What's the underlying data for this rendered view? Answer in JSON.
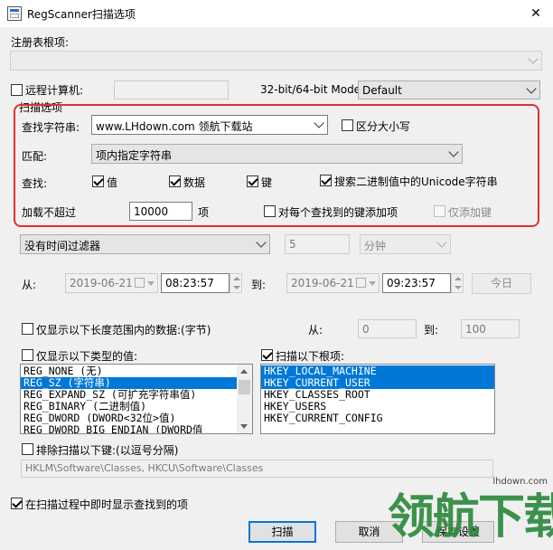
{
  "window": {
    "title": "RegScanner扫描选项",
    "close_glyph": "✕"
  },
  "root_key": {
    "label": "注册表根项:",
    "value": ""
  },
  "remote": {
    "label": "远程计算机:",
    "value": "",
    "checked": false
  },
  "bit_mode": {
    "label": "32-bit/64-bit Mode:",
    "value": "Default"
  },
  "scan_options": {
    "group_label": "扫描选项",
    "find_string_label": "查找字符串:",
    "find_string_value": "www.LHdown.com  领航下载站",
    "case_label": "区分大小写",
    "match_label": "匹配:",
    "match_value": "项内指定字符串",
    "find_label": "查找:",
    "find_value_label": "值",
    "find_data_label": "数据",
    "find_key_label": "键",
    "unicode_label": "搜索二进制值中的Unicode字符串",
    "limit_label": "加载不超过",
    "limit_value": "10000",
    "limit_unit": "项",
    "add_key_label": "对每个查找到的键添加项",
    "only_add_key_label": "仅添加键"
  },
  "time_filter": {
    "value": "没有时间过滤器",
    "amount": "5",
    "unit": "分钟"
  },
  "date_range": {
    "from_label": "从:",
    "from_date": "2019-06-21",
    "from_time": "08:23:57",
    "to_label": "到:",
    "to_date": "2019-06-21",
    "to_time": "09:23:57",
    "today_button": "今日"
  },
  "length_filter": {
    "label": "仅显示以下长度范围内的数据:(字节)",
    "from_label": "从:",
    "from_value": "0",
    "to_label": "到:",
    "to_value": "100"
  },
  "types": {
    "label": "仅显示以下类型的值:",
    "items": [
      "REG_NONE (无)",
      "REG_SZ (字符串)",
      "REG_EXPAND_SZ (可扩充字符串值)",
      "REG_BINARY (二进制值)",
      "REG_DWORD (DWORD<32位>值)",
      "REG_DWORD_BIG_ENDIAN (DWORD值"
    ]
  },
  "roots": {
    "label": "扫描以下根项:",
    "items": [
      "HKEY_LOCAL_MACHINE",
      "HKEY_CURRENT_USER",
      "HKEY_CLASSES_ROOT",
      "HKEY_USERS",
      "HKEY_CURRENT_CONFIG"
    ]
  },
  "exclude": {
    "label": "排除扫描以下键:(以逗号分隔)",
    "value": "HKLM\\Software\\Classes, HKCU\\Software\\Classes"
  },
  "live_display": {
    "label": "在扫描过程中即时显示查找到的项"
  },
  "buttons": {
    "scan": "扫描",
    "cancel": "取消",
    "save": "保存设置"
  },
  "watermark": {
    "url": "lhdown.com",
    "text": "领航下载"
  },
  "colors": {
    "highlight_red": "#e03030",
    "selection_blue": "#0078d7",
    "watermark_green": "#2e8b3e"
  }
}
